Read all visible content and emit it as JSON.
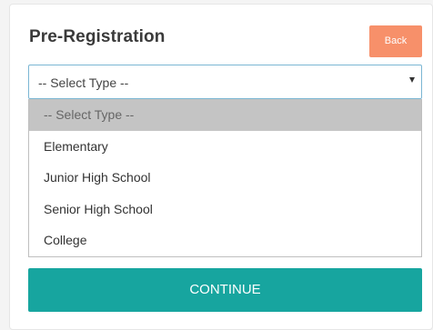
{
  "header": {
    "title": "Pre-Registration",
    "back_label": "Back"
  },
  "type_select": {
    "selected_value": "-- Select Type --",
    "options": [
      "-- Select Type --",
      "Elementary",
      "Junior High School",
      "Senior High School",
      "College"
    ],
    "highlighted_index": 0
  },
  "actions": {
    "continue_label": "CONTINUE"
  },
  "colors": {
    "back_button": "#f7906a",
    "continue_button": "#17a59f",
    "select_border": "#7bb6d3",
    "option_highlight": "#c4c4c4"
  }
}
